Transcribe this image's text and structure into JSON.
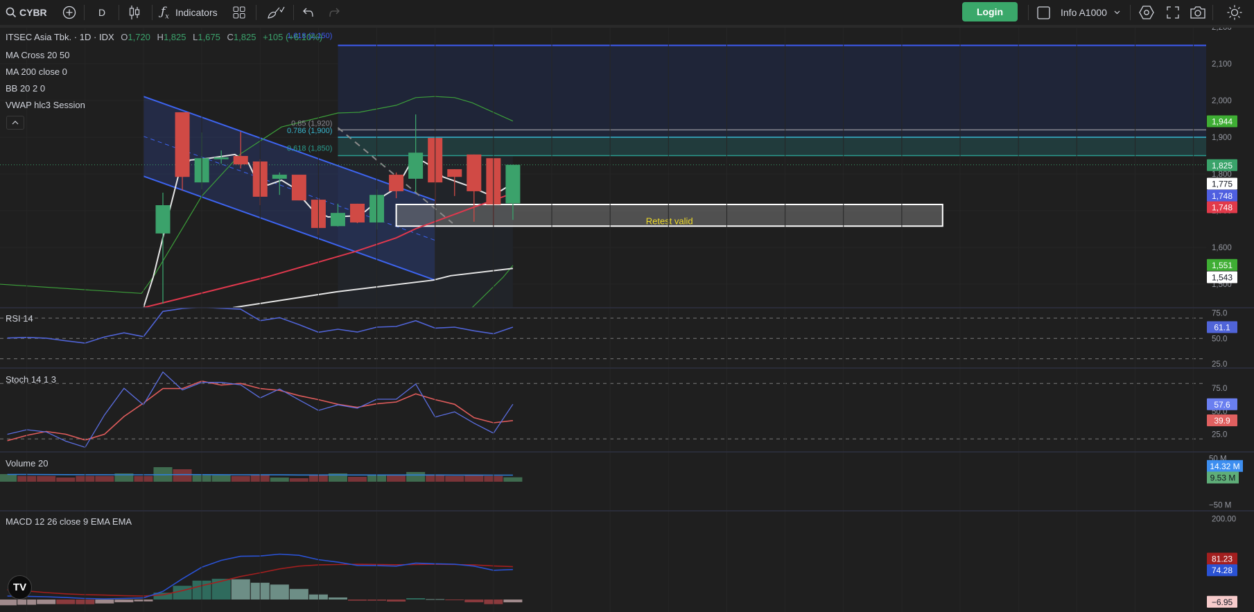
{
  "toolbar": {
    "symbol": "CYBR",
    "interval": "D",
    "indicators_label": "Indicators",
    "login_label": "Login",
    "account_label": "Info A1000",
    "icons": [
      "search-icon",
      "add-symbol-icon",
      "candles-icon",
      "fx-icon",
      "layout-grid-icon",
      "drawing-brush-icon",
      "undo-icon",
      "redo-icon",
      "checkbox-icon",
      "chevron-down-icon",
      "settings-hexagon-icon",
      "fullscreen-icon",
      "camera-icon",
      "theme-sun-icon"
    ]
  },
  "legend": {
    "name": "ITSEC Asia Tbk.",
    "sep": "·",
    "timeframe": "1D",
    "exchange": "IDX",
    "o_label": "O",
    "o": "1,720",
    "h_label": "H",
    "h": "1,825",
    "l_label": "L",
    "l": "1,675",
    "c_label": "C",
    "c": "1,825",
    "change": "+105 (+6.10%)",
    "indicators": [
      "MA Cross 20 50",
      "MA 200 close 0",
      "BB 20 2 0",
      "VWAP hlc3 Session"
    ],
    "collapse_icon": "chevron-up-icon"
  },
  "panes": {
    "rsi": "RSI 14",
    "stoch": "Stoch 14 1 3",
    "volume": "Volume 20",
    "macd": "MACD 12 26 close 9 EMA EMA"
  },
  "chart_data": {
    "type": "candlestick",
    "colors": {
      "up": "#3ba26b",
      "down": "#d04a45",
      "background": "#1f1f1f"
    },
    "price_axis": {
      "ticks": [
        "2,200",
        "2,100",
        "2,000",
        "1,900",
        "1,800",
        "1,700",
        "1,600",
        "1,500"
      ],
      "tick_values": [
        2200,
        2100,
        2000,
        1900,
        1800,
        1700,
        1600,
        1500
      ],
      "ylim": [
        1436,
        2215
      ]
    },
    "candles": [
      {
        "o": 1638,
        "h": 1749,
        "l": 1447,
        "c": 1715
      },
      {
        "o": 1968,
        "h": 1968,
        "l": 1755,
        "c": 1792
      },
      {
        "o": 1777,
        "h": 1913,
        "l": 1758,
        "c": 1843
      },
      {
        "o": 1840,
        "h": 1864,
        "l": 1828,
        "c": 1845
      },
      {
        "o": 1849,
        "h": 1915,
        "l": 1815,
        "c": 1826
      },
      {
        "o": 1834,
        "h": 1840,
        "l": 1715,
        "c": 1738
      },
      {
        "o": 1787,
        "h": 1804,
        "l": 1743,
        "c": 1798
      },
      {
        "o": 1798,
        "h": 1798,
        "l": 1728,
        "c": 1728
      },
      {
        "o": 1730,
        "h": 1734,
        "l": 1634,
        "c": 1653
      },
      {
        "o": 1658,
        "h": 1719,
        "l": 1657,
        "c": 1694
      },
      {
        "o": 1719,
        "h": 1719,
        "l": 1666,
        "c": 1668
      },
      {
        "o": 1668,
        "h": 1758,
        "l": 1649,
        "c": 1743
      },
      {
        "o": 1798,
        "h": 1804,
        "l": 1734,
        "c": 1753
      },
      {
        "o": 1787,
        "h": 1962,
        "l": 1751,
        "c": 1858
      },
      {
        "o": 1898,
        "h": 1898,
        "l": 1717,
        "c": 1777
      },
      {
        "o": 1813,
        "h": 1813,
        "l": 1740,
        "c": 1792
      },
      {
        "o": 1853,
        "h": 1853,
        "l": 1670,
        "c": 1753
      },
      {
        "o": 1843,
        "h": 1843,
        "l": 1660,
        "c": 1717
      },
      {
        "o": 1720,
        "h": 1825,
        "l": 1675,
        "c": 1825
      }
    ],
    "last_price": {
      "value": 1825,
      "label": "1,825",
      "color": "#3aa36a"
    },
    "overlays": {
      "bb_upper": {
        "color": "#3c9f3a",
        "points": [
          [
            -8.4,
            1500
          ],
          [
            -1.1,
            1475
          ],
          [
            -0.5,
            1519
          ],
          [
            2.0,
            1740
          ],
          [
            4.0,
            1855
          ],
          [
            6.1,
            1928
          ],
          [
            9.0,
            1966
          ],
          [
            10.1,
            1968
          ],
          [
            12.0,
            1987
          ],
          [
            13.0,
            2008
          ],
          [
            14.0,
            2011
          ],
          [
            15.0,
            2008
          ],
          [
            15.9,
            1994
          ],
          [
            18.0,
            1944
          ]
        ]
      },
      "bb_lower": {
        "color": "#3c9f3a",
        "points": [
          [
            15.9,
            1436
          ],
          [
            17.5,
            1519
          ],
          [
            18.0,
            1551
          ]
        ]
      },
      "ma_red": {
        "color": "#e0384d",
        "points": [
          [
            -1.0,
            1436
          ],
          [
            5.3,
            1519
          ],
          [
            8.0,
            1560
          ],
          [
            9.9,
            1589
          ],
          [
            12.0,
            1626
          ],
          [
            13.0,
            1651
          ],
          [
            15.9,
            1708
          ],
          [
            17.6,
            1740
          ],
          [
            18.0,
            1748
          ]
        ]
      },
      "ma200": {
        "color": "#e6e6e6",
        "points": [
          [
            3.6,
            1436
          ],
          [
            8.9,
            1479
          ],
          [
            13.9,
            1511
          ],
          [
            14.8,
            1523
          ],
          [
            18.0,
            1543
          ]
        ]
      },
      "vwap": {
        "color": "#e6e6e6",
        "points": [
          [
            -1.0,
            1436
          ],
          [
            -0.5,
            1519
          ],
          [
            0.4,
            1713
          ],
          [
            0.8,
            1796
          ],
          [
            1.4,
            1838
          ],
          [
            2.4,
            1843
          ],
          [
            3.7,
            1853
          ],
          [
            4.4,
            1830
          ],
          [
            4.7,
            1796
          ],
          [
            5.4,
            1770
          ],
          [
            6.1,
            1783
          ],
          [
            6.7,
            1764
          ],
          [
            7.3,
            1726
          ],
          [
            7.7,
            1702
          ],
          [
            8.5,
            1683
          ],
          [
            9.6,
            1685
          ],
          [
            10.4,
            1698
          ],
          [
            11.4,
            1742
          ],
          [
            11.8,
            1755
          ],
          [
            12.4,
            1798
          ],
          [
            12.7,
            1826
          ],
          [
            13.4,
            1834
          ],
          [
            14.0,
            1815
          ],
          [
            14.4,
            1792
          ],
          [
            15.7,
            1768
          ],
          [
            16.7,
            1745
          ],
          [
            17.4,
            1755
          ],
          [
            18.0,
            1775
          ]
        ]
      }
    },
    "price_labels": [
      {
        "text": "1,944",
        "value": 1944,
        "bg": "#3fae34",
        "fg": "#ffffff"
      },
      {
        "text": "1,825",
        "value": 1825,
        "bg": "#3aa36a",
        "fg": "#ffffff"
      },
      {
        "text": "1,775",
        "value": 1775,
        "bg": "#ffffff",
        "fg": "#131722"
      },
      {
        "text": "1,748",
        "value": 1748,
        "bg": "#4f5fe0",
        "fg": "#ffffff"
      },
      {
        "text": "1,748",
        "value": 1748,
        "bg": "#e23a4a",
        "fg": "#ffffff"
      },
      {
        "text": "1,551",
        "value": 1551,
        "bg": "#3fae34",
        "fg": "#ffffff"
      },
      {
        "text": "1,543",
        "value": 1543,
        "bg": "#ffffff",
        "fg": "#131722"
      }
    ],
    "drawings": {
      "channel": {
        "upper": [
          [
            -1,
            2011
          ],
          [
            14,
            1728
          ]
        ],
        "lower": [
          [
            -1,
            1794
          ],
          [
            14,
            1511
          ]
        ],
        "color": "#3d64f0"
      },
      "fib": {
        "start_index": 9,
        "levels": [
          {
            "ratio": "1.618",
            "price": 2150,
            "label": "1.618 (2,150)",
            "color": "#3d5cf5"
          },
          {
            "ratio": "0.85",
            "price": 1920,
            "label": "0.85 (1,920)",
            "color": "#8a8a94"
          },
          {
            "ratio": "0.786",
            "price": 1900,
            "label": "0.786 (1,900)",
            "color": "#38b8d0"
          },
          {
            "ratio": "0.618",
            "price": 1850,
            "label": "0.618 (1,850)",
            "color": "#2a9d8f"
          }
        ]
      },
      "trend_dashed": {
        "points": [
          [
            9.0,
            1926
          ],
          [
            14.9,
            1666
          ]
        ],
        "color": "#8a8a8a"
      },
      "retest_box": {
        "from_index": 12.0,
        "to_index": 40.1,
        "top": 1717,
        "bottom": 1658,
        "label": "Retest valid",
        "text_color": "#f0dc28"
      }
    },
    "rsi": {
      "start_index": -8,
      "color": "#5064d8",
      "values": [
        50.4,
        51.0,
        50.3,
        47.7,
        45.4,
        51.5,
        55.5,
        51.8,
        76.6,
        79.5,
        80.7,
        79.7,
        78.8,
        67.5,
        70.5,
        63.6,
        56.1,
        59.1,
        56.3,
        61.1,
        61.8,
        67.5,
        60.2,
        61.1,
        57.5,
        54.6,
        61.1
      ],
      "bands": [
        70,
        50,
        30
      ],
      "ticks": [
        "75.0",
        "50.0",
        "25.0"
      ],
      "tick_values": [
        75,
        50,
        25
      ],
      "label": {
        "text": "61.1",
        "bg": "#5064d8"
      }
    },
    "stoch": {
      "start_index": -8,
      "k_color": "#5b6ee1",
      "d_color": "#e05c5c",
      "k": [
        25.0,
        30.0,
        27.6,
        17.6,
        10.9,
        46.0,
        74.8,
        56.9,
        92.4,
        73.0,
        81.2,
        81.2,
        78.6,
        64.4,
        74.1,
        62.3,
        50.8,
        56.9,
        53.2,
        63.0,
        63.0,
        79.4,
        43.7,
        49.3,
        37.0,
        26.2,
        57.6
      ],
      "d": [
        18.1,
        23.9,
        28.1,
        25.1,
        18.8,
        25.1,
        44.3,
        58.8,
        74.5,
        74.5,
        82.6,
        78.3,
        80.1,
        74.5,
        72.6,
        66.9,
        62.5,
        57.5,
        54.2,
        58.0,
        60.0,
        68.8,
        62.5,
        57.5,
        43.0,
        37.5,
        39.9
      ],
      "bands": [
        80,
        20
      ],
      "ticks": [
        "75.0",
        "50.0",
        "25.0"
      ],
      "tick_values": [
        75,
        50,
        25
      ],
      "labels": [
        {
          "text": "57.6",
          "value": 57.6,
          "bg": "#6a7ff0"
        },
        {
          "text": "39.9",
          "value": 39.9,
          "bg": "#e06060"
        }
      ]
    },
    "volume": {
      "start_index": -8,
      "unit": "M",
      "up_color": "#3f6b4f",
      "down_color": "#7a3438",
      "ma_color": "#2f7fd8",
      "values": [
        16.5,
        12.5,
        12.5,
        9.0,
        12.5,
        12.5,
        18.0,
        12.5,
        31.5,
        27.0,
        14.0,
        14.0,
        12.5,
        14.0,
        9.0,
        7.5,
        14.0,
        18.0,
        10.5,
        14.0,
        14.0,
        21.0,
        14.0,
        12.5,
        15.0,
        12.5,
        9.53
      ],
      "direction": [
        "up",
        "down",
        "down",
        "down",
        "down",
        "down",
        "up",
        "down",
        "up",
        "down",
        "up",
        "up",
        "down",
        "down",
        "up",
        "down",
        "down",
        "up",
        "down",
        "up",
        "down",
        "up",
        "down",
        "down",
        "down",
        "down",
        "up"
      ],
      "ma": [
        15.8,
        15.6,
        15.4,
        15.3,
        15.2,
        15.1,
        15.0,
        15.0,
        15.2,
        15.4,
        15.3,
        15.2,
        15.0,
        14.9,
        14.8,
        14.6,
        14.6,
        14.7,
        14.5,
        14.5,
        14.5,
        14.6,
        14.5,
        14.4,
        14.4,
        14.3,
        14.32
      ],
      "ticks": [
        "50 M",
        "−50 M"
      ],
      "tick_values": [
        50,
        -50
      ],
      "labels": [
        {
          "text": "14.32 M",
          "value": 14.32,
          "bg": "#3d8ef0",
          "fg": "#ffffff"
        },
        {
          "text": "9.53 M",
          "value": 9.53,
          "bg": "#5fae78",
          "fg": "#131722"
        }
      ]
    },
    "macd": {
      "start_index": -8,
      "macd_color": "#2a52d4",
      "signal_color": "#a31f1f",
      "macd": [
        8.5,
        7.8,
        6.8,
        5.0,
        2.5,
        1.7,
        2.8,
        4.0,
        20.0,
        51.3,
        79.8,
        96.9,
        107.0,
        107.7,
        112.3,
        109.4,
        98.6,
        92.3,
        84.3,
        83.8,
        82.6,
        90.1,
        88.4,
        87.2,
        82.6,
        72.3,
        74.28
      ],
      "signal": [
        24.0,
        21.0,
        17.1,
        14.0,
        12.0,
        11.0,
        9.5,
        8.5,
        11.4,
        22.0,
        34.2,
        45.0,
        57.0,
        66.0,
        75.8,
        82.6,
        85.5,
        86.5,
        87.2,
        86.8,
        86.0,
        86.5,
        87.2,
        86.5,
        85.5,
        83.0,
        81.23
      ],
      "histogram": [
        -14.2,
        -13.0,
        -11.4,
        -11.4,
        -11.6,
        -9.7,
        -6.8,
        -4.6,
        17.0,
        34.0,
        46.7,
        51.3,
        50.0,
        41.5,
        37.0,
        26.2,
        12.5,
        5.1,
        -2.8,
        -2.8,
        -5.0,
        3.4,
        1.0,
        -1.0,
        -6.8,
        -11.4,
        -6.95
      ],
      "hist_colors": {
        "pos_up": "#2f6b5d",
        "pos_down": "#6d8e86",
        "neg_down": "#8b3a3d",
        "neg_up": "#a08a8c"
      },
      "ticks": [
        "200.00"
      ],
      "tick_values": [
        200
      ],
      "labels": [
        {
          "text": "81.23",
          "value": 81.23,
          "bg": "#a31f1f",
          "fg": "#ffffff"
        },
        {
          "text": "74.28",
          "value": 74.28,
          "bg": "#2a52d4",
          "fg": "#ffffff"
        },
        {
          "text": "−6.95",
          "value": -6.95,
          "bg": "#f7cbcb",
          "fg": "#131722"
        }
      ]
    }
  }
}
